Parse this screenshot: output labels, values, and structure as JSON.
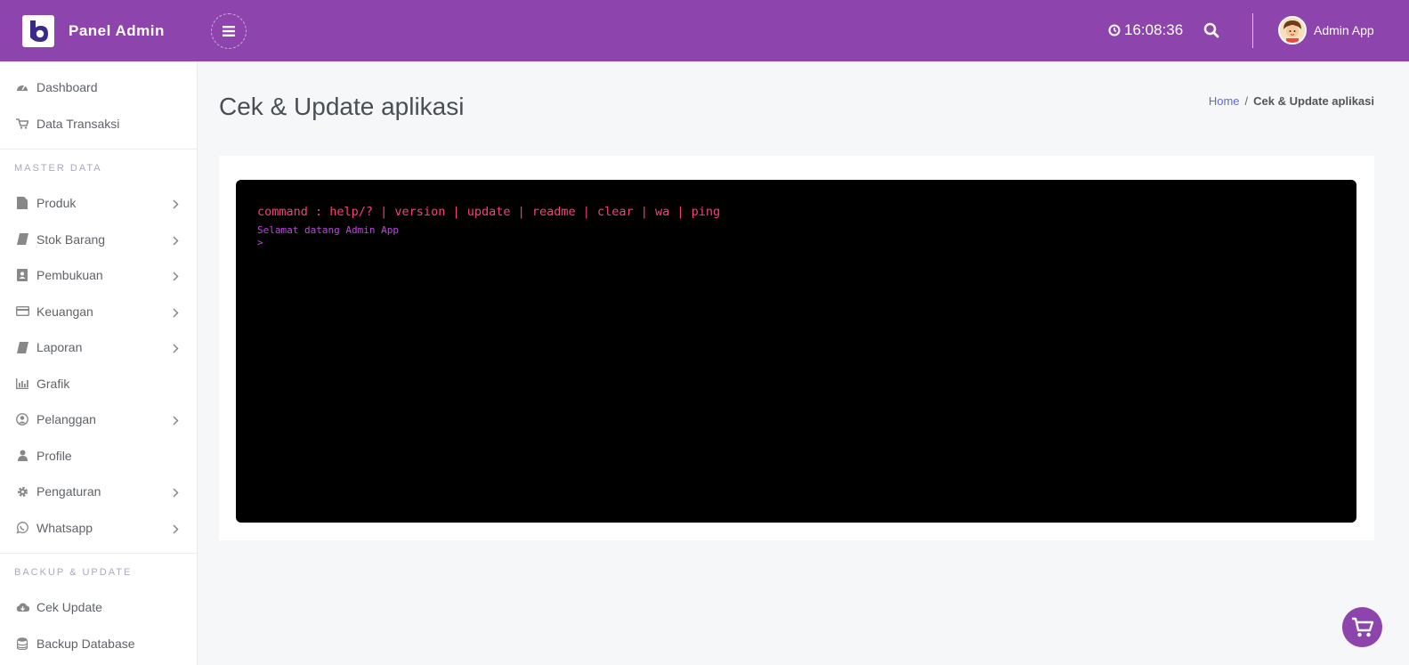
{
  "header": {
    "brand_title": "Panel Admin",
    "clock": "16:08:36",
    "user_name": "Admin App",
    "color": "#8e44ad"
  },
  "sidebar": {
    "top_items": [
      {
        "label": "Dashboard",
        "icon": "dashboard-icon"
      },
      {
        "label": "Data Transaksi",
        "icon": "cart-icon"
      }
    ],
    "master_title": "MASTER DATA",
    "master_items": [
      {
        "label": "Produk",
        "icon": "file-icon",
        "submenu": true
      },
      {
        "label": "Stok Barang",
        "icon": "book-icon",
        "submenu": true
      },
      {
        "label": "Pembukuan",
        "icon": "contact-book-icon",
        "submenu": true
      },
      {
        "label": "Keuangan",
        "icon": "credit-card-icon",
        "submenu": true
      },
      {
        "label": "Laporan",
        "icon": "book-icon",
        "submenu": true
      },
      {
        "label": "Grafik",
        "icon": "bar-chart-icon",
        "submenu": false
      },
      {
        "label": "Pelanggan",
        "icon": "user-circle-icon",
        "submenu": true
      },
      {
        "label": "Profile",
        "icon": "user-icon",
        "submenu": false
      },
      {
        "label": "Pengaturan",
        "icon": "gear-icon",
        "submenu": true
      },
      {
        "label": "Whatsapp",
        "icon": "whatsapp-icon",
        "submenu": true
      }
    ],
    "backup_title": "BACKUP & UPDATE",
    "backup_items": [
      {
        "label": "Cek Update",
        "icon": "cloud-download-icon"
      },
      {
        "label": "Backup Database",
        "icon": "database-icon"
      }
    ]
  },
  "main": {
    "page_title": "Cek & Update aplikasi",
    "breadcrumb_home": "Home",
    "breadcrumb_sep": "/",
    "breadcrumb_current": "Cek & Update aplikasi"
  },
  "terminal": {
    "command_line": "command : help/? | version | update | readme | clear | wa | ping",
    "welcome": "Selamat datang Admin App",
    "prompt": ">"
  }
}
